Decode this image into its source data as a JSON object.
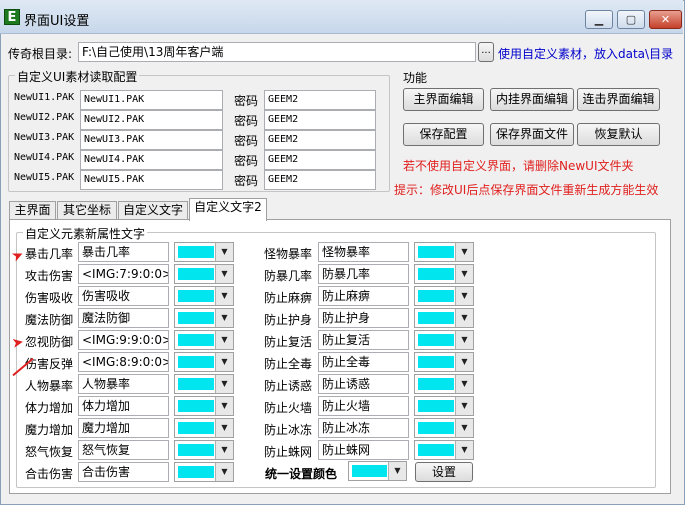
{
  "window": {
    "title": "界面UI设置",
    "icon_letter": "E",
    "min_label": "▁",
    "max_label": "▢",
    "close_label": "✕"
  },
  "path": {
    "label": "传奇根目录:",
    "value": "F:\\自己使用\\13周年客户端",
    "browse_label": "...",
    "link": "使用自定义素材，放入data\\目录"
  },
  "custom_pak": {
    "group_label": "自定义UI素材读取配置",
    "password_label": "密码",
    "rows": [
      {
        "name": "NewUI1.PAK",
        "file": "NewUI1.PAK",
        "password": "GEEM2"
      },
      {
        "name": "NewUI2.PAK",
        "file": "NewUI2.PAK",
        "password": "GEEM2"
      },
      {
        "name": "NewUI3.PAK",
        "file": "NewUI3.PAK",
        "password": "GEEM2"
      },
      {
        "name": "NewUI4.PAK",
        "file": "NewUI4.PAK",
        "password": "GEEM2"
      },
      {
        "name": "NewUI5.PAK",
        "file": "NewUI5.PAK",
        "password": "GEEM2"
      }
    ]
  },
  "functions": {
    "label": "功能",
    "main_ui_edit": "主界面编辑",
    "plugin_ui_edit": "内挂界面编辑",
    "combo_ui_edit": "连击界面编辑",
    "save_config": "保存配置",
    "save_ui_file": "保存界面文件",
    "restore_default": "恢复默认",
    "note_red": "若不使用自定义界面，请删除NewUI文件夹",
    "hint": "提示：修改UI后点保存界面文件重新生成方能生效"
  },
  "tabs": [
    "主界面",
    "其它坐标",
    "自定义文字",
    "自定义文字2"
  ],
  "panel": {
    "group_label": "自定义元素新属性文字",
    "swatch_color": "#00e5ee",
    "left_rows": [
      {
        "label": "暴击几率",
        "value": "暴击几率"
      },
      {
        "label": "攻击伤害",
        "value": "<IMG:7:9:0:0>"
      },
      {
        "label": "伤害吸收",
        "value": "伤害吸收"
      },
      {
        "label": "魔法防御",
        "value": "魔法防御"
      },
      {
        "label": "忽视防御",
        "value": "<IMG:9:9:0:0>"
      },
      {
        "label": "伤害反弹",
        "value": "<IMG:8:9:0:0>"
      },
      {
        "label": "人物暴率",
        "value": "人物暴率"
      },
      {
        "label": "体力增加",
        "value": "体力增加"
      },
      {
        "label": "魔力增加",
        "value": "魔力增加"
      },
      {
        "label": "怒气恢复",
        "value": "怒气恢复"
      },
      {
        "label": "合击伤害",
        "value": "合击伤害"
      }
    ],
    "right_rows": [
      {
        "label": "怪物暴率",
        "value": "怪物暴率"
      },
      {
        "label": "防暴几率",
        "value": "防暴几率"
      },
      {
        "label": "防止麻痹",
        "value": "防止麻痹"
      },
      {
        "label": "防止护身",
        "value": "防止护身"
      },
      {
        "label": "防止复活",
        "value": "防止复活"
      },
      {
        "label": "防止全毒",
        "value": "防止全毒"
      },
      {
        "label": "防止诱惑",
        "value": "防止诱惑"
      },
      {
        "label": "防止火墙",
        "value": "防止火墙"
      },
      {
        "label": "防止冰冻",
        "value": "防止冰冻"
      },
      {
        "label": "防止蛛网",
        "value": "防止蛛网"
      }
    ],
    "unify_label": "统一设置颜色",
    "set_button": "设置"
  }
}
